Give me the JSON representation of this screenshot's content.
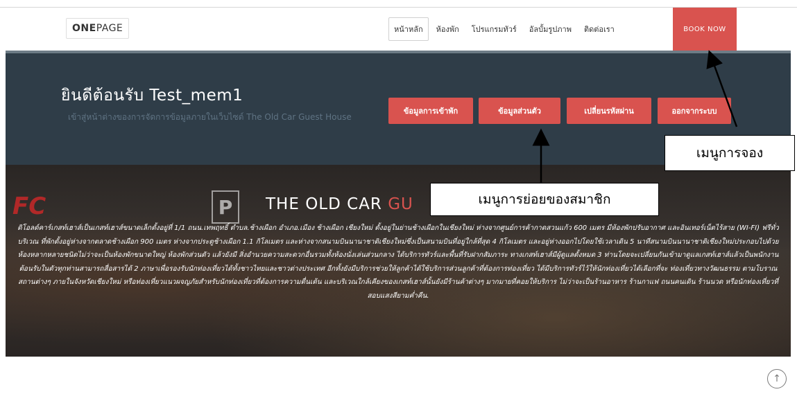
{
  "navbar": {
    "logo_bold": "ONE",
    "logo_rest": "PAGE",
    "items": [
      {
        "label": "หน้าหลัก"
      },
      {
        "label": "ห้องพัก"
      },
      {
        "label": "โปรแกรมทัวร์"
      },
      {
        "label": "อัลบั้มรูปภาพ"
      },
      {
        "label": "ติดต่อเรา"
      }
    ],
    "book_now": "BOOK NOW"
  },
  "member": {
    "welcome": "ยินดีต้อนรับ Test_mem1",
    "subtitle": "เข้าสู่หน้าต่างของการจัดการข้อมูลภายในเว็บไซต์ The Old Car Guest House",
    "buttons": [
      {
        "label": "ข้อมูลการเข้าพัก"
      },
      {
        "label": "ข้อมูลส่วนตัว"
      },
      {
        "label": "เปลี่ยนรหัสผ่าน"
      },
      {
        "label": "ออกจากระบบ"
      }
    ]
  },
  "hero": {
    "sign_fc": "FC",
    "sign_p": "P",
    "title_main": "THE OLD CAR ",
    "title_accent": "GU",
    "description": "ดิโอลด์คาร์เกสท์เฮาส์เป็นเกสท์เฮาส์ขนาดเล็กตั้งอยู่ที่ 1/1 ถนน.เทพฤทธิ์ ตำบล.ช้างเผือก อำเภอ.เมือง ช้างเผือก เชียงใหม่ ตั้งอยู่ในย่านช้างเผือกในเชียงใหม่ ห่างจากศูนย์การค้ากาดสวนแก้ว 600 เมตร มีห้องพักปรับอากาศ และอินเทอร์เน็ตไร้สาย (WI-FI) ฟรีทั่วบริเวณ ที่พักตั้งอยู่ห่างจากตลาดช้างเผือก 900 เมตร ห่างจากประตูช้างเผือก 1.1 กิโลเมตร และห่างจากสนามบินนานาชาติเชียงใหม่ซึ่งเป็นสนามบินที่อยู่ใกล้ที่สุด 4 กิโลเมตร และอยู่ห่างออกไปโดยใช้เวลาเดิน 5 นาทีสนามบินนานาชาติเชียงใหม่ประกอบไปด้วยห้องหลากหลายชนิดไม่ว่าจะเป็นห้องพักขนาดใหญ่ ห้องพักส่วนตัว แล้วยังมี สิ่งอำนวยความสะดวกอื่นรวมทั้งห้องนั่งเล่นส่วนกลาง ได้บริการทัวร์และพื้นที่รับฝากสัมภาระ ทางเกสท์เฮาส์มีผู้ดูแลตั้งหมด 3 ท่านโดยจะเปลี่ยนกันเข้ามาดูแลเกสท์เฮาส์แล้วเป็นพนักงานต้อนรับในตัวทุกท่านสามารถสื่อสารได้ 2 ภาษาเพื่อรองรับนักท่องเที่ยวได้ทั้งชาวไทยและชาวต่างประเทศ อีกทั้งยังมีบริการช่วยให้ลูกค้าได้ใช้บริการส่วนลูกค้าที่ต้องการท่องเที่ยว ได้มีบริการทัวร์ไว้ให้นักท่องเที่ยวได้เลือกที่จะ ท่องเที่ยวทางวัฒนธรรม ตามโบราณสถานต่างๆ ภายในจังหวัดเชียงใหม่ หรือท่องเที่ยวแนวผจญภัยสำหรับนักท่องเที่ยวที่ต้องการความตื่นเต้น และบริเวณใกล้เคียงของเกสท์เฮาส์นั้นยังมีร้านค้าต่างๆ มากมายที่คอยให้บริการ ไม่ว่าจะเป็นร้านอาหาร ร้านกาแฟ ถนนคนเดิน ร้านนวด หรือนักท่องเที่ยวที่สอบแสงสียามค่ำคืน."
  },
  "annotations": {
    "booking_menu": "เมนูการจอง",
    "member_submenu": "เมนูการย่อยของสมาชิก"
  },
  "scroll_top_icon": "arrow-up-circle-icon"
}
